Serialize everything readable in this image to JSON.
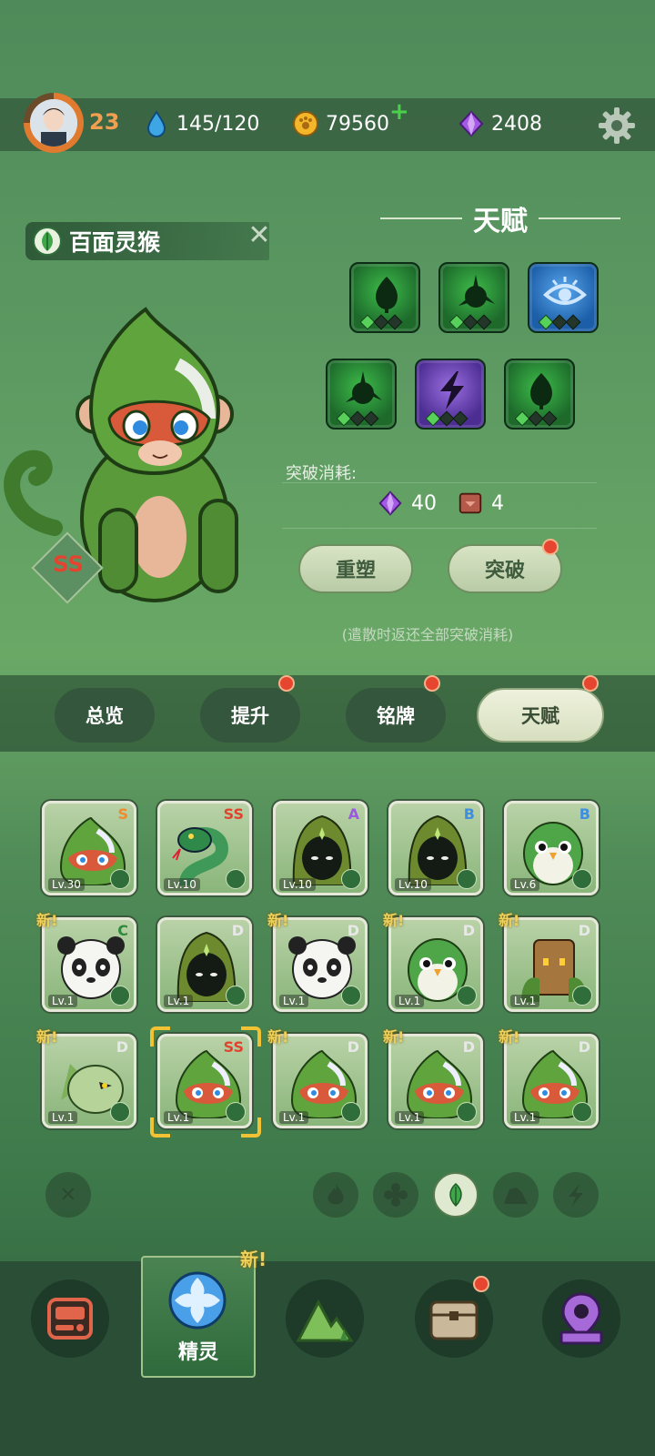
{
  "status": {
    "level": "23",
    "energy": "145/120",
    "coins": "79560",
    "coins_plus": "+",
    "gems": "2408"
  },
  "pet": {
    "name": "百面灵猴",
    "rank": "SS"
  },
  "talent": {
    "title": "天赋",
    "skills": [
      {
        "color": "green",
        "icon": "drop-icon",
        "level": 1
      },
      {
        "color": "green",
        "icon": "spiky-orb-icon",
        "level": 1
      },
      {
        "color": "blue",
        "icon": "eye-icon",
        "level": 1
      },
      {
        "color": "green",
        "icon": "spiky-orb-icon",
        "level": 1
      },
      {
        "color": "purple",
        "icon": "lightning-icon",
        "level": 1
      },
      {
        "color": "green",
        "icon": "drop-icon",
        "level": 1
      }
    ],
    "cost_label": "突破消耗:",
    "cost_gems": "40",
    "cost_cards": "4",
    "reshape_label": "重塑",
    "breakthrough_label": "突破",
    "note": "(遣散时返还全部突破消耗)"
  },
  "tabs": [
    {
      "label": "总览",
      "dot": false
    },
    {
      "label": "提升",
      "dot": true
    },
    {
      "label": "铭牌",
      "dot": true
    },
    {
      "label": "天赋",
      "dot": true,
      "active": true
    }
  ],
  "pets": [
    {
      "grade": "S",
      "grade_color": "#f08a2a",
      "lv": "Lv.30",
      "kind": "monkey",
      "new": false
    },
    {
      "grade": "SS",
      "grade_color": "#e0442f",
      "lv": "Lv.10",
      "kind": "snake",
      "new": false
    },
    {
      "grade": "A",
      "grade_color": "#9b5be0",
      "lv": "Lv.10",
      "kind": "hood",
      "new": false
    },
    {
      "grade": "B",
      "grade_color": "#3f8fe0",
      "lv": "Lv.10",
      "kind": "hood",
      "new": false
    },
    {
      "grade": "B",
      "grade_color": "#3f8fe0",
      "lv": "Lv.6",
      "kind": "bird",
      "new": false
    },
    {
      "grade": "C",
      "grade_color": "#2f8a3c",
      "lv": "Lv.1",
      "kind": "panda",
      "new": true
    },
    {
      "grade": "D",
      "grade_color": "#e8e8e8",
      "lv": "Lv.1",
      "kind": "hood",
      "new": false
    },
    {
      "grade": "D",
      "grade_color": "#e8e8e8",
      "lv": "Lv.1",
      "kind": "panda",
      "new": true
    },
    {
      "grade": "D",
      "grade_color": "#e8e8e8",
      "lv": "Lv.1",
      "kind": "bird",
      "new": true
    },
    {
      "grade": "D",
      "grade_color": "#e8e8e8",
      "lv": "Lv.1",
      "kind": "stump",
      "new": true
    },
    {
      "grade": "D",
      "grade_color": "#e8e8e8",
      "lv": "Lv.1",
      "kind": "dragon",
      "new": true
    },
    {
      "grade": "SS",
      "grade_color": "#e0442f",
      "lv": "Lv.1",
      "kind": "monkey",
      "new": false,
      "selected": true
    },
    {
      "grade": "D",
      "grade_color": "#e8e8e8",
      "lv": "Lv.1",
      "kind": "monkey",
      "new": true
    },
    {
      "grade": "D",
      "grade_color": "#e8e8e8",
      "lv": "Lv.1",
      "kind": "monkey",
      "new": true
    },
    {
      "grade": "D",
      "grade_color": "#e8e8e8",
      "lv": "Lv.1",
      "kind": "monkey",
      "new": true
    }
  ],
  "new_label": "新!",
  "filters": [
    "close-icon",
    "fire-icon",
    "ice-icon",
    "leaf-icon",
    "rock-icon",
    "lightning-icon"
  ],
  "nav": {
    "items": [
      "device-icon",
      "sprite-icon",
      "mountain-icon",
      "chest-icon",
      "map-pin-icon"
    ],
    "active_label": "精灵",
    "new_label": "新!"
  }
}
